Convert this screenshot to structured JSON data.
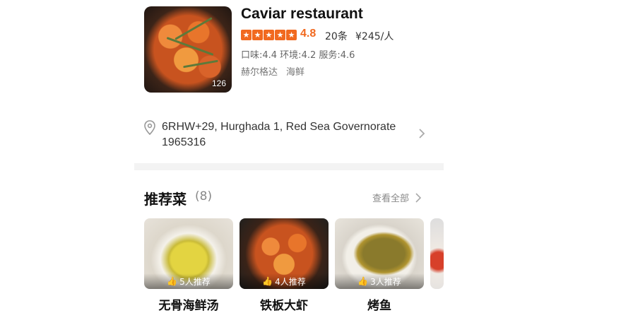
{
  "restaurant": {
    "name": "Caviar restaurant",
    "photo_count": "126",
    "rating": "4.8",
    "review_count": "20条",
    "price_per_person": "¥245/人",
    "scores": "口味:4.4 环境:4.2 服务:4.6",
    "tags": [
      "赫尔格达",
      "海鲜"
    ],
    "address": "6RHW+29, Hurghada 1, Red Sea Governorate 1965316",
    "accent_color": "#f1691f"
  },
  "recommended": {
    "title": "推荐菜",
    "count": "(8)",
    "see_all": "查看全部",
    "dishes": [
      {
        "name": "无骨海鲜汤",
        "recommend": "5人推荐"
      },
      {
        "name": "铁板大虾",
        "recommend": "4人推荐"
      },
      {
        "name": "烤鱼",
        "recommend": "3人推荐"
      }
    ]
  },
  "icons": {
    "location": "location-pin-icon",
    "chevron": "chevron-right-icon",
    "like": "thumbs-up-icon",
    "star": "star-icon"
  }
}
